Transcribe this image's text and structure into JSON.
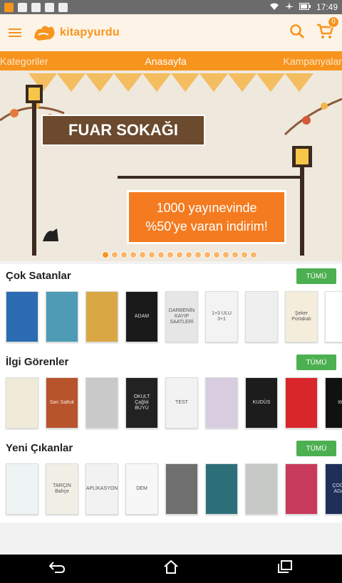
{
  "status_bar": {
    "time": "17:49"
  },
  "app_bar": {
    "logo_text": "kitapyurdu",
    "cart_count": "0"
  },
  "nav": {
    "items": [
      "Kategoriler",
      "Anasayfa",
      "Kampanyalar"
    ]
  },
  "banner": {
    "sign_text": "FUAR SOKAĞI",
    "promo_line1": "1000 yayınevinde",
    "promo_line2": "%50'ye varan indirim!"
  },
  "sections": [
    {
      "title": "Çok Satanlar",
      "button": "TÜMÜ",
      "books": [
        {
          "color": "#2b6cb3"
        },
        {
          "color": "#4d9bb5"
        },
        {
          "color": "#d9a845"
        },
        {
          "color": "#1a1a1a",
          "label": "ADAM"
        },
        {
          "color": "#e6e6e6",
          "label": "DARBENİN KAYIP SAATLERİ",
          "light": true
        },
        {
          "color": "#f3f3f3",
          "label": "1+3 ULU 3+1",
          "light": true
        },
        {
          "color": "#efefef",
          "light": true
        },
        {
          "color": "#f5eddc",
          "label": "Şeker Portakalı",
          "light": true
        },
        {
          "color": "#ffffff",
          "light": true
        }
      ]
    },
    {
      "title": "İlgi Görenler",
      "button": "TÜMÜ",
      "books": [
        {
          "color": "#efebd8",
          "light": true
        },
        {
          "color": "#b8542c",
          "label": "Sarı Saltuk"
        },
        {
          "color": "#c9c9c9",
          "light": true
        },
        {
          "color": "#222222",
          "label": "OKULT Çağlık BÜYÜ"
        },
        {
          "color": "#f2f2f2",
          "label": "TEST",
          "light": true
        },
        {
          "color": "#d8cde0",
          "light": true
        },
        {
          "color": "#1c1c1c",
          "label": "KUDÜS"
        },
        {
          "color": "#d9262a"
        },
        {
          "color": "#111111",
          "label": "töv"
        }
      ]
    },
    {
      "title": "Yeni Çıkanlar",
      "button": "TÜMÜ",
      "books": [
        {
          "color": "#eef3f3",
          "light": true
        },
        {
          "color": "#f1eee6",
          "label": "TARÇIN Bahçe",
          "light": true
        },
        {
          "color": "#f2f2f2",
          "label": "APLİKASYON",
          "light": true
        },
        {
          "color": "#f7f7f7",
          "label": "DEM",
          "light": true
        },
        {
          "color": "#6f6f6f"
        },
        {
          "color": "#2d6f79"
        },
        {
          "color": "#c7c9c6",
          "light": true
        },
        {
          "color": "#c83a59"
        },
        {
          "color": "#1f2f5a",
          "label": "ÇOCUK ADASI"
        }
      ]
    }
  ]
}
